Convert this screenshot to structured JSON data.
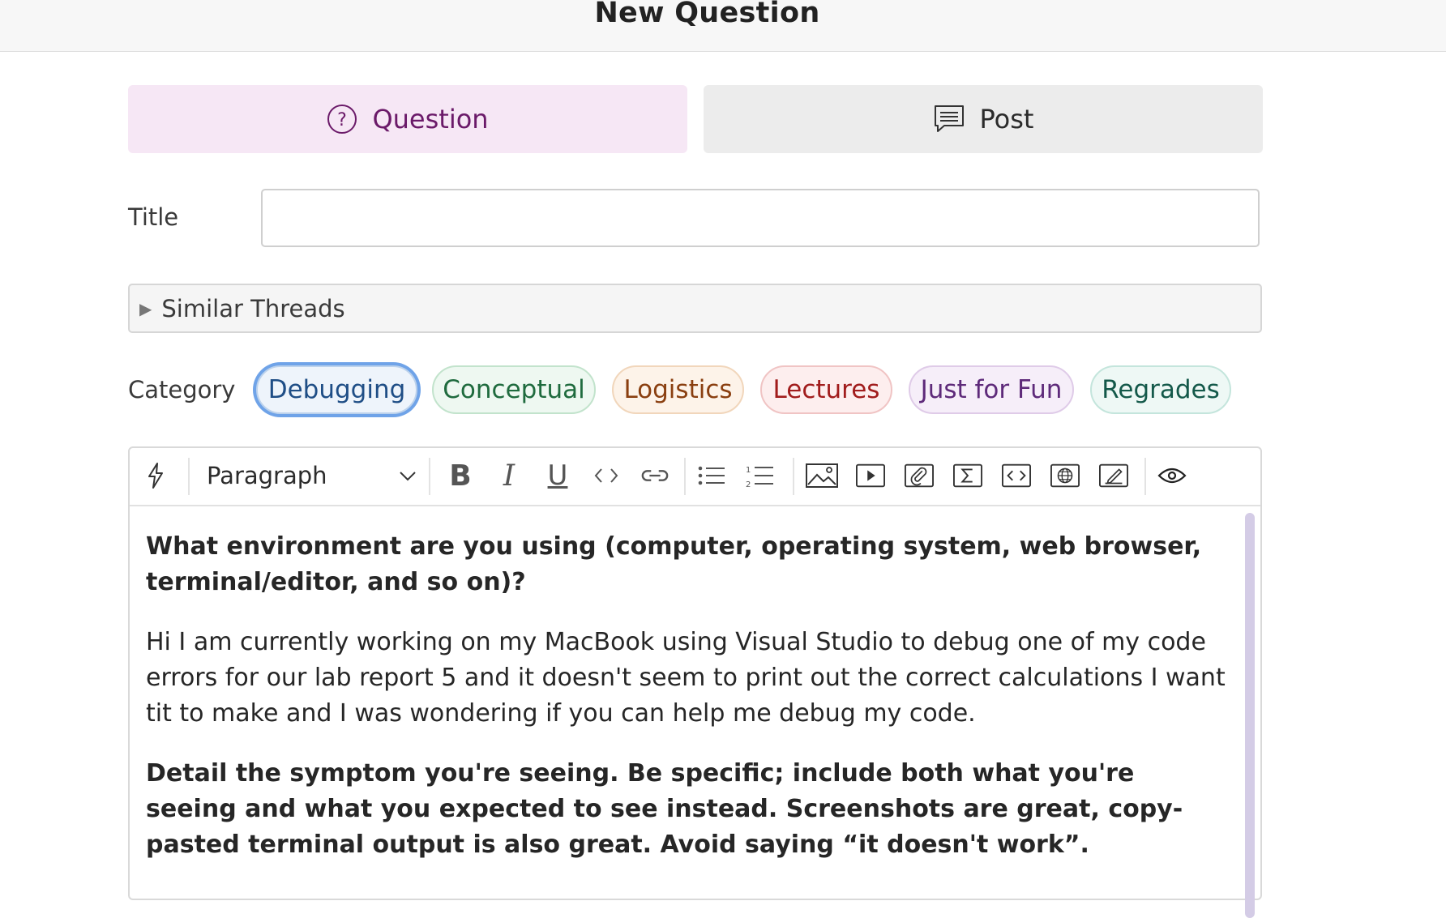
{
  "header": {
    "title": "New Question"
  },
  "type_selector": {
    "question_label": "Question",
    "post_label": "Post",
    "question_icon": "question-circle-icon",
    "post_icon": "comment-lines-icon"
  },
  "title_field": {
    "label": "Title",
    "value": "",
    "placeholder": ""
  },
  "similar_threads": {
    "label": "Similar Threads",
    "expanded": false
  },
  "category": {
    "label": "Category",
    "selected": "Debugging",
    "options": [
      {
        "label": "Debugging",
        "color": "#1f4e86",
        "bg": "#eef4fb"
      },
      {
        "label": "Conceptual",
        "color": "#1f6b3e",
        "bg": "#eef8f1"
      },
      {
        "label": "Logistics",
        "color": "#8a3f10",
        "bg": "#fdf3e9"
      },
      {
        "label": "Lectures",
        "color": "#a11c1c",
        "bg": "#fdeeee"
      },
      {
        "label": "Just for Fun",
        "color": "#5e2a7a",
        "bg": "#f6eef9"
      },
      {
        "label": "Regrades",
        "color": "#14594a",
        "bg": "#eef8f5"
      }
    ]
  },
  "editor": {
    "block_format": "Paragraph",
    "toolbar_icons": [
      "lightning-icon",
      "bold-icon",
      "italic-icon",
      "underline-icon",
      "code-icon",
      "link-icon",
      "bullet-list-icon",
      "numbered-list-icon",
      "image-icon",
      "video-icon",
      "attachment-icon",
      "math-icon",
      "code-block-icon",
      "web-embed-icon",
      "drawing-icon",
      "preview-icon"
    ],
    "content": {
      "prompt1": "What environment are you using (computer, operating system, web browser, terminal/editor, and so on)?",
      "answer1": "Hi I am currently working on my MacBook using Visual Studio to debug one of my code errors for our lab report 5 and it doesn't seem to print out the correct calculations I want tit to make and I was wondering if you can help me debug my code.",
      "prompt2": "Detail the symptom you're seeing. Be specific; include both what you're seeing and what you expected to see instead. Screenshots are great, copy-pasted terminal output is also great. Avoid saying “it doesn't work”."
    }
  },
  "colors": {
    "accent": "#6b1a69",
    "selected_ring": "#6fa3e8"
  }
}
